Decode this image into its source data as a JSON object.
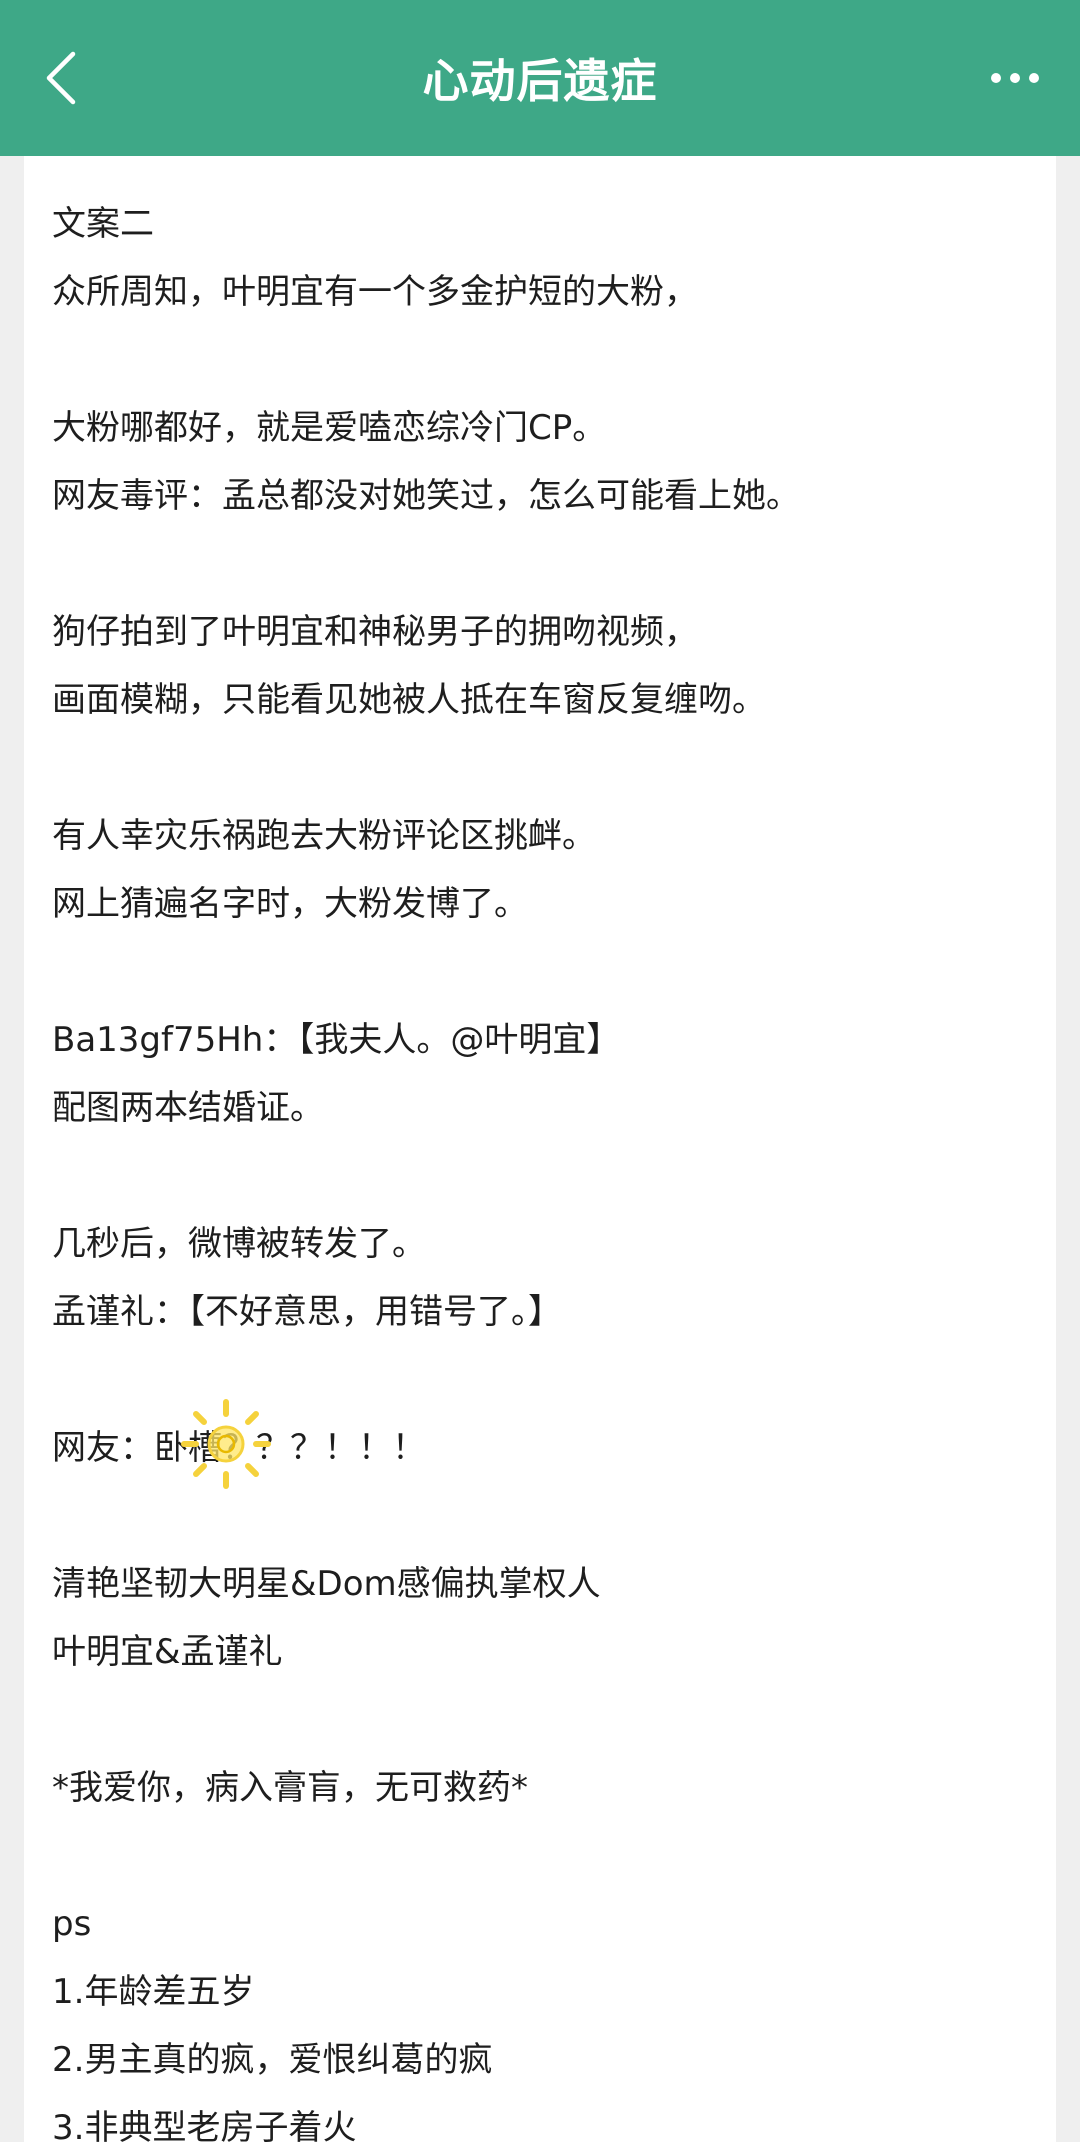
{
  "header": {
    "title": "心动后遗症",
    "back_icon": "chevron-left-icon",
    "more_icon": "more-dots-icon"
  },
  "colors": {
    "header_bg": "#3ea887",
    "page_bg": "#efefef",
    "text": "#1e1e1e",
    "sticker": "#f5d23c"
  },
  "article": {
    "lines": [
      "文案二",
      "众所周知，叶明宜有一个多金护短的大粉，",
      "",
      "大粉哪都好，就是爱嗑恋综冷门CP。",
      "网友毒评：孟总都没对她笑过，怎么可能看上她。",
      "",
      "狗仔拍到了叶明宜和神秘男子的拥吻视频，",
      "画面模糊，只能看见她被人抵在车窗反复缠吻。",
      "",
      "有人幸灾乐祸跑去大粉评论区挑衅。",
      "网上猜遍名字时，大粉发博了。",
      "",
      "Ba13gf75Hh：【我夫人。@叶明宜】",
      "配图两本结婚证。",
      "",
      "几秒后，微博被转发了。",
      "孟谨礼：【不好意思，用错号了。】",
      "",
      "网友：卧槽？？？！！！",
      "",
      "清艳坚韧大明星&Dom感偏执掌权人",
      "叶明宜&孟谨礼",
      "",
      "*我爱你，病入膏肓，无可救药*",
      "",
      "ps",
      "1.年龄差五岁",
      "2.男主真的疯，爱恨纠葛的疯",
      "3.非典型老房子着火"
    ]
  }
}
